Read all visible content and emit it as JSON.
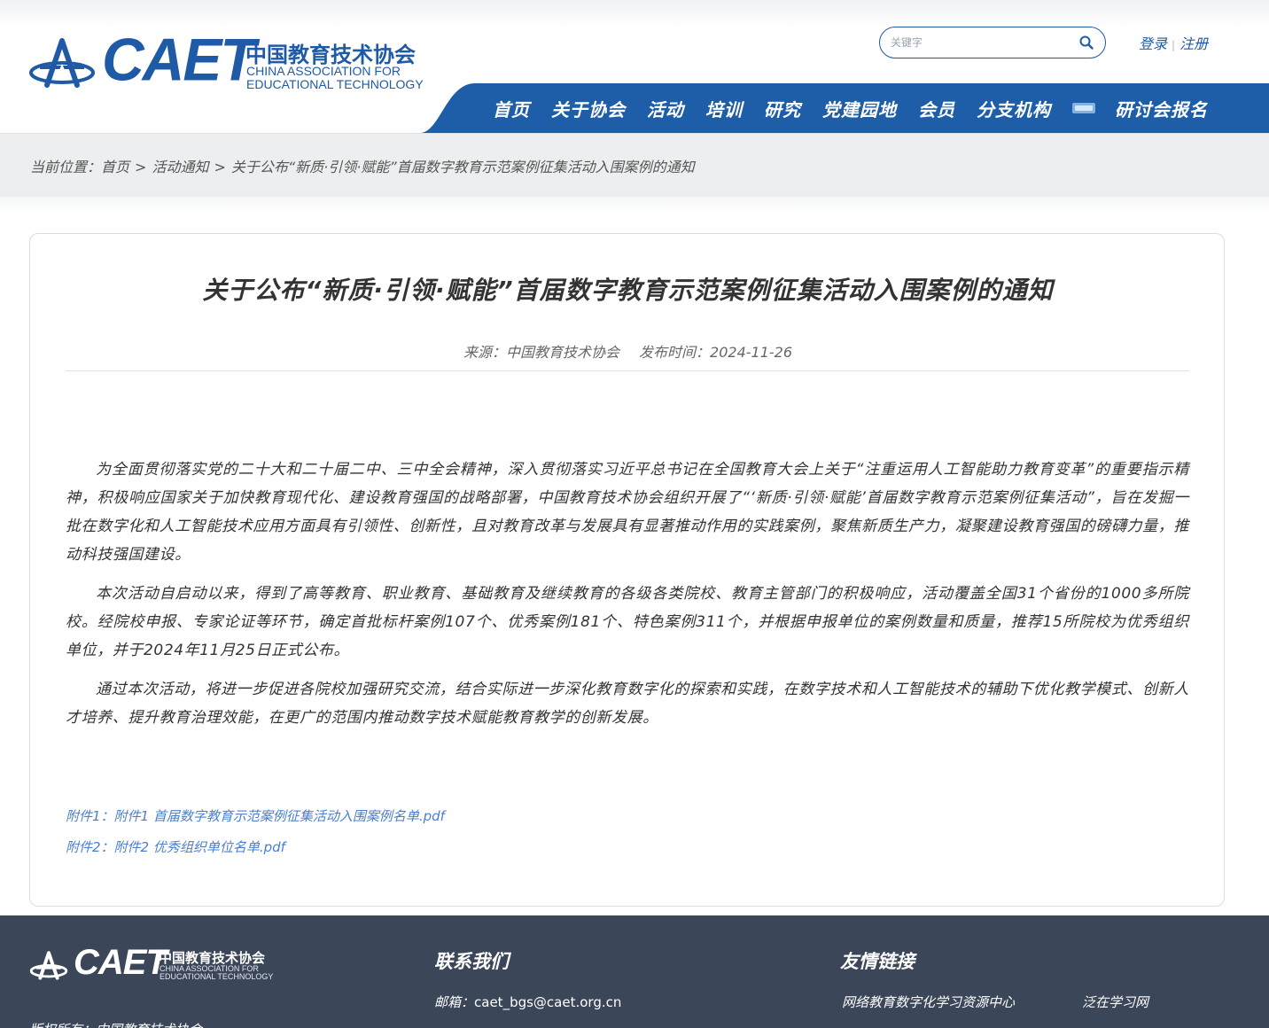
{
  "header": {
    "logo": {
      "word": "CAET",
      "name_cn": "中国教育技术协会",
      "name_en_line1": "CHINA ASSOCIATION FOR",
      "name_en_line2": "EDUCATIONAL TECHNOLOGY"
    },
    "search": {
      "placeholder": "关键字",
      "icon": "search-icon"
    },
    "auth": {
      "login": "登录",
      "register": "注册"
    },
    "nav": {
      "items": [
        "首页",
        "关于协会",
        "活动",
        "培训",
        "研究",
        "党建园地",
        "会员",
        "分支机构",
        "研讨会报名"
      ],
      "badge_icon": "new-badge-icon"
    },
    "colors": {
      "brand_blue": "#1f5aa6",
      "nav_blue": "#1e5ea8"
    }
  },
  "breadcrumb": {
    "prefix": "当前位置：",
    "items": [
      "首页",
      "活动通知",
      "关于公布“新质·引领·赋能”首届数字教育示范案例征集活动入围案例的通知"
    ]
  },
  "article": {
    "title": "关于公布“新质·引领·赋能”首届数字教育示范案例征集活动入围案例的通知",
    "source_label": "来源：",
    "source": "中国教育技术协会",
    "date_label": "发布时间：",
    "date": "2024-11-26",
    "paragraphs": [
      "为全面贯彻落实党的二十大和二十届二中、三中全会精神，深入贯彻落实习近平总书记在全国教育大会上关于“注重运用人工智能助力教育变革”的重要指示精神，积极响应国家关于加快教育现代化、建设教育强国的战略部署，中国教育技术协会组织开展了“‘新质·引领·赋能’首届数字教育示范案例征集活动”，旨在发掘一批在数字化和人工智能技术应用方面具有引领性、创新性，且对教育改革与发展具有显著推动作用的实践案例，聚焦新质生产力，凝聚建设教育强国的磅礴力量，推动科技强国建设。",
      "本次活动自启动以来，得到了高等教育、职业教育、基础教育及继续教育的各级各类院校、教育主管部门的积极响应，活动覆盖全国31个省份的1000多所院校。经院校申报、专家论证等环节，确定首批标杆案例107个、优秀案例181个、特色案例311个，并根据申报单位的案例数量和质量，推荐15所院校为优秀组织单位，并于2024年11月25日正式公布。",
      "通过本次活动，将进一步促进各院校加强研究交流，结合实际进一步深化教育数字化的探索和实践，在数字技术和人工智能技术的辅助下优化教学模式、创新人才培养、提升教育治理效能，在更广的范围内推动数字技术赋能教育教学的创新发展。"
    ],
    "attachments": [
      {
        "label": "附件1：",
        "name": "附件1 首届数字教育示范案例征集活动入围案例名单.pdf"
      },
      {
        "label": "附件2：",
        "name": "附件2 优秀组织单位名单.pdf"
      }
    ]
  },
  "footer": {
    "logo": {
      "word": "CAET",
      "name_cn": "中国教育技术协会",
      "name_en_line1": "CHINA ASSOCIATION FOR",
      "name_en_line2": "EDUCATIONAL TECHNOLOGY"
    },
    "copyright": "版权所有：中国教育技术协会",
    "contact": {
      "heading": "联系我们",
      "email_label": "邮箱：",
      "email": "caet_bgs@caet.org.cn"
    },
    "links": {
      "heading": "友情链接",
      "items": [
        "网络教育数字化学习资源中心",
        "泛在学习网"
      ]
    },
    "background": "#3b4658"
  }
}
